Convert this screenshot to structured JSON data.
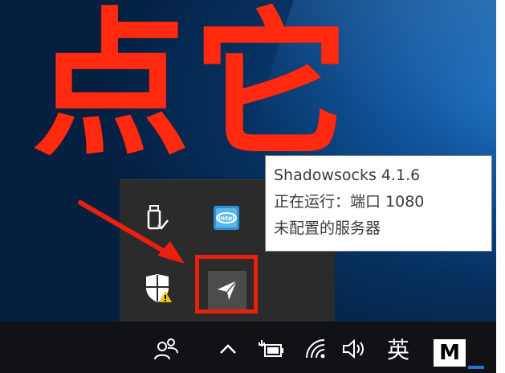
{
  "annotation": {
    "big_text": "点它"
  },
  "tooltip": {
    "line1": "Shadowsocks 4.1.6",
    "line2": "正在运行：端口 1080",
    "line3": "未配置的服务器"
  },
  "tray_popup": {
    "icons": [
      "usb-drive-icon",
      "intel-graphics-icon",
      "windows-defender-warning-icon",
      "shadowsocks-icon"
    ]
  },
  "taskbar": {
    "icons": [
      "people-icon",
      "chevron-up-icon",
      "battery-charging-icon",
      "wifi-icon",
      "volume-icon"
    ],
    "ime_label": "英",
    "m_label": "M"
  },
  "colors": {
    "annotation_red": "#ff2a10",
    "highlight_red": "#e8200d",
    "taskbar_bg": "#101215",
    "popup_bg": "#2b2b2b"
  }
}
